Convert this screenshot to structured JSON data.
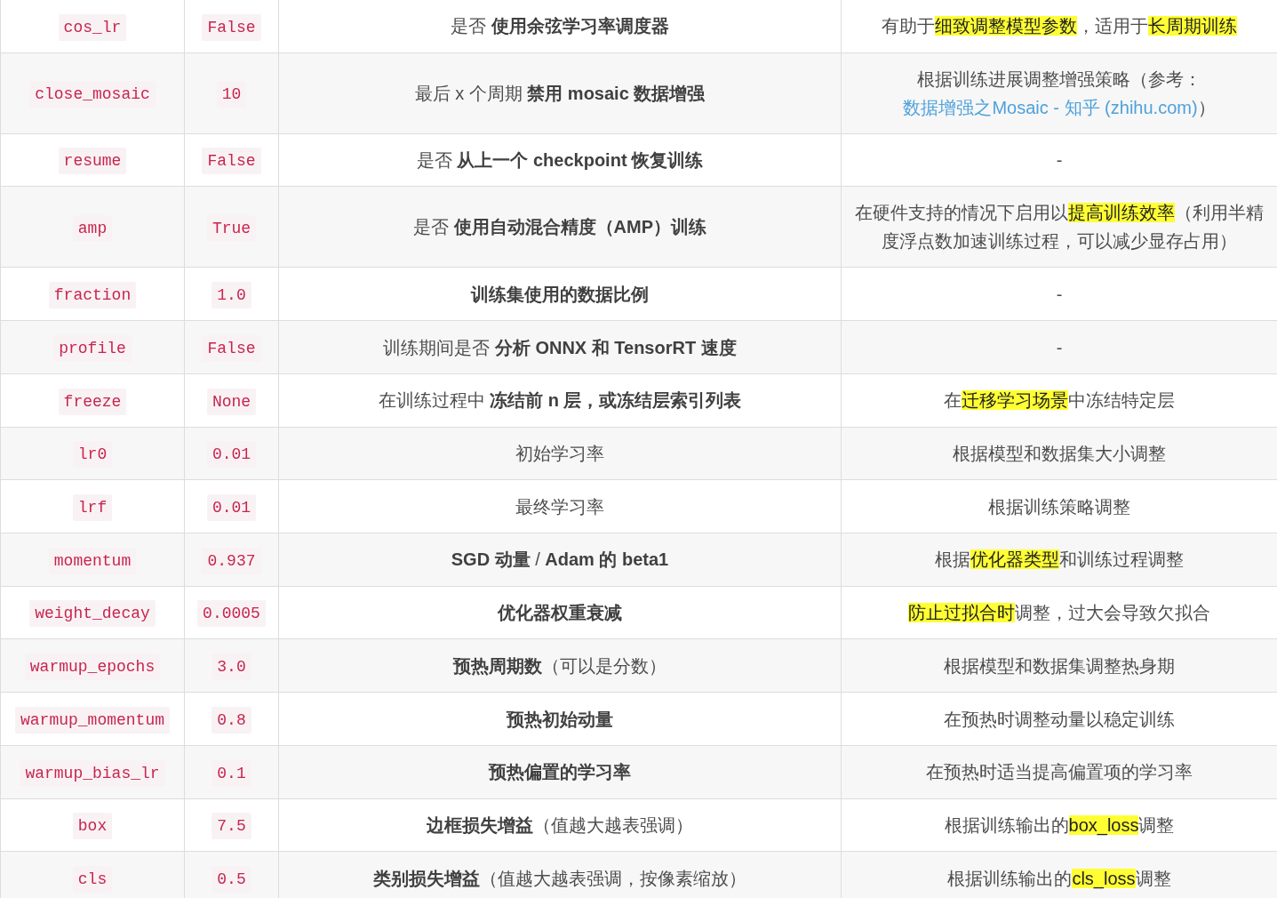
{
  "table": {
    "rows": [
      {
        "parameter": "cos_lr",
        "default_value": "False",
        "description": "是否 **使用余弦学习率调度器**",
        "note": [
          {
            "kind": "plain",
            "text": "有助于"
          },
          {
            "kind": "mark",
            "text": "细致调整模型参数"
          },
          {
            "kind": "plain",
            "text": "，适用于"
          },
          {
            "kind": "mark",
            "text": "长周期训练"
          }
        ]
      },
      {
        "parameter": "close_mosaic",
        "default_value": "10",
        "description": "最后 x 个周期 **禁用 mosaic 数据增强**",
        "note": [
          {
            "kind": "plain",
            "text": "根据训练进展调整增强策略（参考："
          },
          {
            "kind": "link",
            "text": "数据增强之Mosaic - 知乎 (zhihu.com)"
          },
          {
            "kind": "plain",
            "text": "）"
          }
        ]
      },
      {
        "parameter": "resume",
        "default_value": "False",
        "description": "是否 **从上一个 checkpoint 恢复训练**",
        "note": [
          {
            "kind": "plain",
            "text": "-"
          }
        ]
      },
      {
        "parameter": "amp",
        "default_value": "True",
        "description": "是否 **使用自动混合精度（AMP）训练**",
        "note": [
          {
            "kind": "plain",
            "text": "在硬件支持的情况下启用以"
          },
          {
            "kind": "mark",
            "text": "提高训练效率"
          },
          {
            "kind": "plain",
            "text": "（利用半精度浮点数加速训练过程，可以减少显存占用）"
          }
        ]
      },
      {
        "parameter": "fraction",
        "default_value": "1.0",
        "description": "**训练集使用的数据比例**",
        "note": [
          {
            "kind": "plain",
            "text": "-"
          }
        ]
      },
      {
        "parameter": "profile",
        "default_value": "False",
        "description": "训练期间是否 **分析 ONNX 和 TensorRT 速度**",
        "note": [
          {
            "kind": "plain",
            "text": "-"
          }
        ]
      },
      {
        "parameter": "freeze",
        "default_value": "None",
        "description": "在训练过程中 **冻结前 n 层，或冻结层索引列表**",
        "note": [
          {
            "kind": "plain",
            "text": "在"
          },
          {
            "kind": "mark",
            "text": "迁移学习场景"
          },
          {
            "kind": "plain",
            "text": "中冻结特定层"
          }
        ]
      },
      {
        "parameter": "lr0",
        "default_value": "0.01",
        "description": "初始学习率",
        "note": [
          {
            "kind": "plain",
            "text": "根据模型和数据集大小调整"
          }
        ]
      },
      {
        "parameter": "lrf",
        "default_value": "0.01",
        "description": "最终学习率",
        "note": [
          {
            "kind": "plain",
            "text": "根据训练策略调整"
          }
        ]
      },
      {
        "parameter": "momentum",
        "default_value": "0.937",
        "description": "**SGD 动量** / **Adam 的 beta1**",
        "note": [
          {
            "kind": "plain",
            "text": "根据"
          },
          {
            "kind": "mark",
            "text": "优化器类型"
          },
          {
            "kind": "plain",
            "text": "和训练过程调整"
          }
        ]
      },
      {
        "parameter": "weight_decay",
        "default_value": "0.0005",
        "description": "**优化器权重衰减**",
        "note": [
          {
            "kind": "mark",
            "text": "防止过拟合时"
          },
          {
            "kind": "plain",
            "text": "调整，过大会导致欠拟合"
          }
        ]
      },
      {
        "parameter": "warmup_epochs",
        "default_value": "3.0",
        "description": "**预热周期数**（可以是分数）",
        "note": [
          {
            "kind": "plain",
            "text": "根据模型和数据集调整热身期"
          }
        ]
      },
      {
        "parameter": "warmup_momentum",
        "default_value": "0.8",
        "description": "**预热初始动量**",
        "note": [
          {
            "kind": "plain",
            "text": "在预热时调整动量以稳定训练"
          }
        ]
      },
      {
        "parameter": "warmup_bias_lr",
        "default_value": "0.1",
        "description": "**预热偏置的学习率**",
        "note": [
          {
            "kind": "plain",
            "text": "在预热时适当提高偏置项的学习率"
          }
        ]
      },
      {
        "parameter": "box",
        "default_value": "7.5",
        "description": "**边框损失增益**（值越大越表强调）",
        "note": [
          {
            "kind": "plain",
            "text": "根据训练输出的"
          },
          {
            "kind": "mark",
            "text": "box_loss"
          },
          {
            "kind": "plain",
            "text": "调整"
          }
        ]
      },
      {
        "parameter": "cls",
        "default_value": "0.5",
        "description": "**类别损失增益**（值越大越表强调，按像素缩放）",
        "note": [
          {
            "kind": "plain",
            "text": "根据训练输出的"
          },
          {
            "kind": "mark",
            "text": "cls_loss"
          },
          {
            "kind": "plain",
            "text": "调整"
          }
        ]
      }
    ]
  }
}
